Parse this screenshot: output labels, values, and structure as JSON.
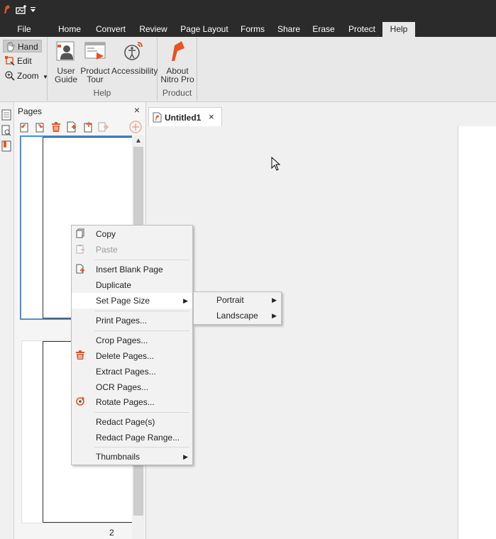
{
  "colors": {
    "titlebar": "#2b2b2b",
    "ribbon": "#e8e8e8",
    "accent": "#e8521e",
    "selection": "#4a90d9"
  },
  "menubar": {
    "tabs": [
      {
        "label": "File"
      },
      {
        "label": "Home"
      },
      {
        "label": "Convert"
      },
      {
        "label": "Review"
      },
      {
        "label": "Page Layout"
      },
      {
        "label": "Forms"
      },
      {
        "label": "Share"
      },
      {
        "label": "Erase"
      },
      {
        "label": "Protect"
      },
      {
        "label": "Help"
      }
    ],
    "active": "Help"
  },
  "ribbon": {
    "hand": "Hand",
    "edit": "Edit",
    "zoom": "Zoom",
    "help_group": {
      "label": "Help",
      "user_guide": [
        "User",
        "Guide"
      ],
      "product_tour": [
        "Product",
        "Tour"
      ],
      "accessibility": "Accessibility"
    },
    "product_group": {
      "label": "Product",
      "about": [
        "About",
        "Nitro Pro"
      ]
    }
  },
  "pages_panel": {
    "title": "Pages",
    "close": "×",
    "page_number": "2"
  },
  "document": {
    "tab_title": "Untitled1",
    "tab_close": "×"
  },
  "context_menu": {
    "items": [
      {
        "label": "Copy",
        "icon": "copy-icon"
      },
      {
        "label": "Paste",
        "icon": "paste-icon",
        "disabled": true
      },
      {
        "label": "Insert Blank Page",
        "icon": "insert-page-icon"
      },
      {
        "label": "Duplicate"
      },
      {
        "label": "Set Page Size",
        "submenu": true
      },
      {
        "label": "Print Pages..."
      },
      {
        "label": "Crop Pages..."
      },
      {
        "label": "Delete Pages...",
        "icon": "trash-icon"
      },
      {
        "label": "Extract Pages..."
      },
      {
        "label": "OCR Pages..."
      },
      {
        "label": "Rotate Pages...",
        "icon": "rotate-icon"
      },
      {
        "label": "Redact Page(s)"
      },
      {
        "label": "Redact Page Range..."
      },
      {
        "label": "Thumbnails",
        "submenu": true
      }
    ]
  },
  "submenu": {
    "items": [
      {
        "label": "Portrait"
      },
      {
        "label": "Landscape"
      }
    ]
  }
}
